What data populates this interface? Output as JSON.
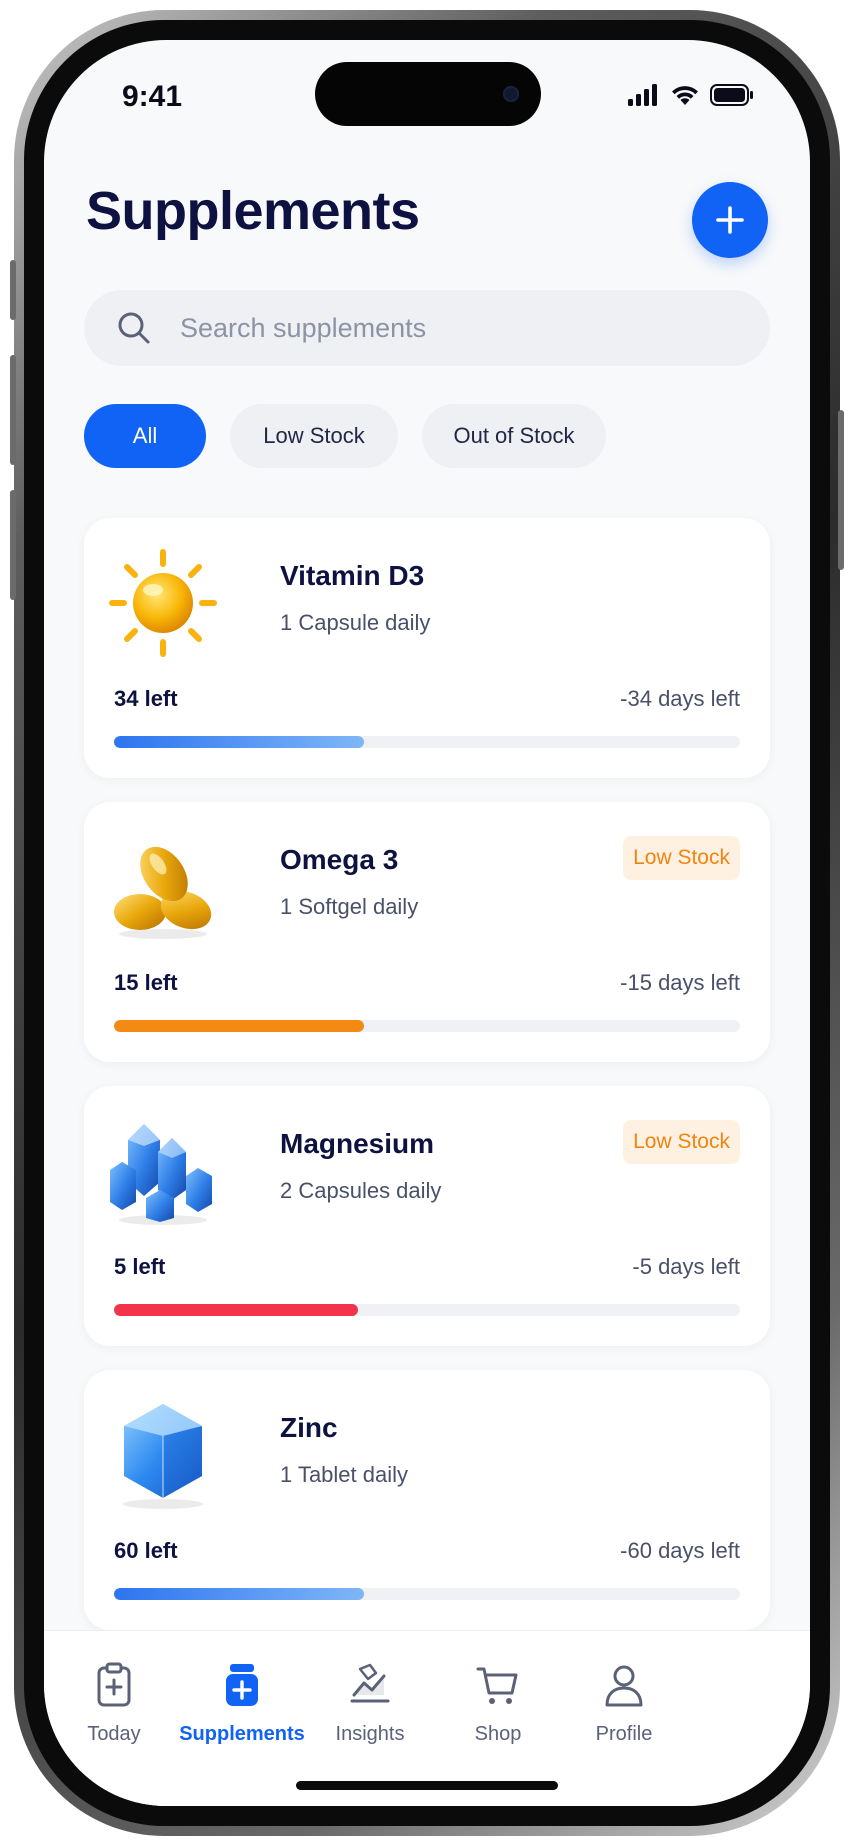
{
  "status": {
    "time": "9:41"
  },
  "header": {
    "title": "Supplements",
    "add_icon": "plus-icon"
  },
  "search": {
    "placeholder": "Search supplements",
    "icon": "search-icon"
  },
  "filters": [
    {
      "label": "All",
      "active": true
    },
    {
      "label": "Low Stock",
      "active": false
    },
    {
      "label": "Out of Stock",
      "active": false
    }
  ],
  "supplements": [
    {
      "name": "Vitamin D3",
      "dose": "1 Capsule daily",
      "left": "34 left",
      "days": "-34 days left",
      "badge": "",
      "progress": 0.4,
      "color": "#2d74f0",
      "icon": "sun-icon"
    },
    {
      "name": "Omega 3",
      "dose": "1 Softgel daily",
      "left": "15 left",
      "days": "-15 days left",
      "badge": "Low Stock",
      "progress": 0.4,
      "color": "#f48a14",
      "icon": "softgel-icon"
    },
    {
      "name": "Magnesium",
      "dose": "2 Capsules daily",
      "left": "5 left",
      "days": "-5 days left",
      "badge": "Low Stock",
      "progress": 0.39,
      "color": "#f2334a",
      "icon": "crystal-cluster-icon"
    },
    {
      "name": "Zinc",
      "dose": "1 Tablet daily",
      "left": "60 left",
      "days": "-60 days left",
      "badge": "",
      "progress": 0.4,
      "color": "#2d74f0",
      "icon": "gem-icon"
    }
  ],
  "tabs": [
    {
      "label": "Today",
      "icon": "clipboard-plus-icon",
      "active": false
    },
    {
      "label": "Supplements",
      "icon": "pill-bottle-icon",
      "active": true
    },
    {
      "label": "Insights",
      "icon": "chart-icon",
      "active": false
    },
    {
      "label": "Shop",
      "icon": "cart-icon",
      "active": false
    },
    {
      "label": "Profile",
      "icon": "person-icon",
      "active": false
    }
  ],
  "colors": {
    "accent": "#1063f5",
    "warning": "#f08412",
    "danger": "#f2334a"
  }
}
